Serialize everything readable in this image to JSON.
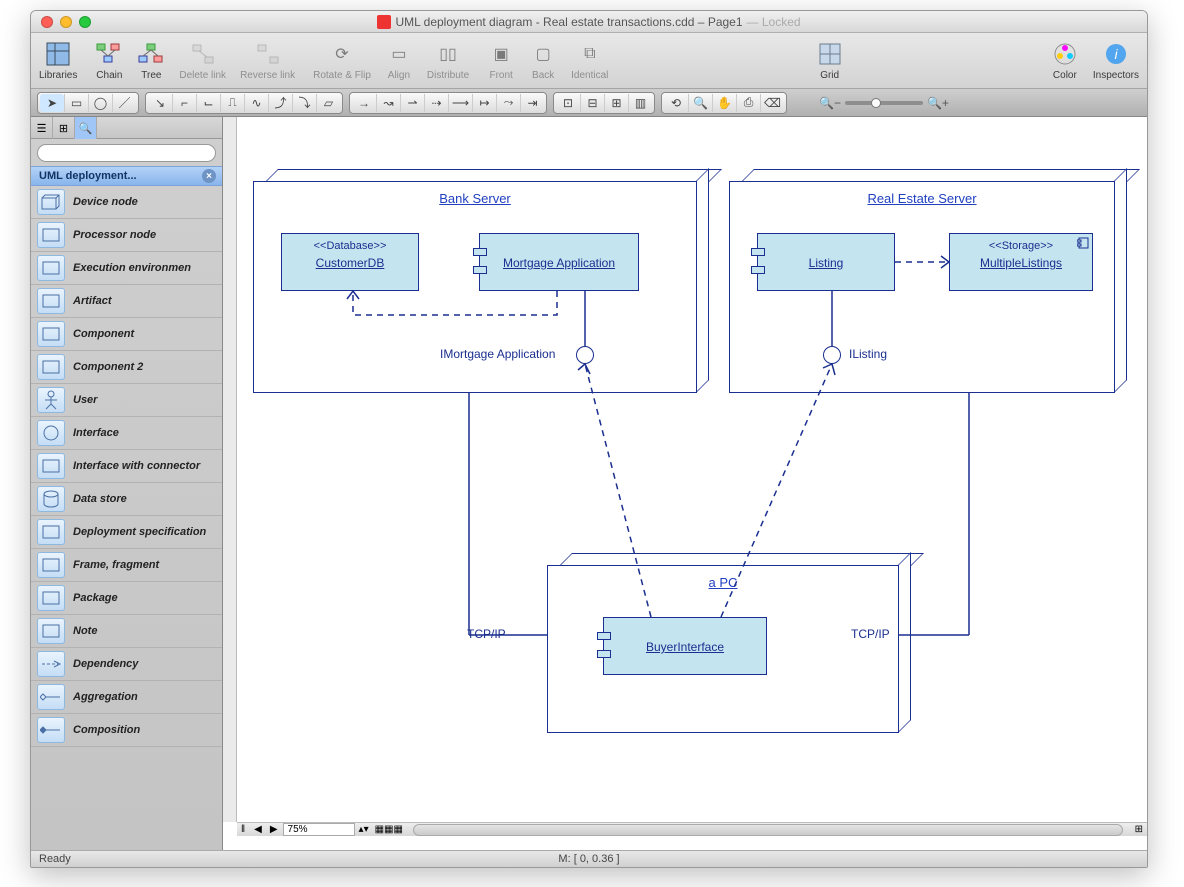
{
  "window": {
    "title_main": "UML deployment diagram - Real estate transactions.cdd – Page1",
    "title_locked": "— Locked"
  },
  "toolbar": {
    "items": [
      {
        "label": "Libraries",
        "disabled": false
      },
      {
        "label": "Chain",
        "disabled": false
      },
      {
        "label": "Tree",
        "disabled": false
      },
      {
        "label": "Delete link",
        "disabled": true
      },
      {
        "label": "Reverse link",
        "disabled": true
      },
      {
        "label": "Rotate & Flip",
        "disabled": true
      },
      {
        "label": "Align",
        "disabled": true
      },
      {
        "label": "Distribute",
        "disabled": true
      },
      {
        "label": "Front",
        "disabled": true
      },
      {
        "label": "Back",
        "disabled": true
      },
      {
        "label": "Identical",
        "disabled": true
      },
      {
        "label": "Grid",
        "disabled": false
      },
      {
        "label": "Color",
        "disabled": false
      },
      {
        "label": "Inspectors",
        "disabled": false
      }
    ]
  },
  "sidebar": {
    "section_title": "UML deployment...",
    "search_placeholder": "",
    "items": [
      {
        "label": "Device node"
      },
      {
        "label": "Processor node"
      },
      {
        "label": "Execution environmen"
      },
      {
        "label": "Artifact"
      },
      {
        "label": "Component"
      },
      {
        "label": "Component 2"
      },
      {
        "label": "User"
      },
      {
        "label": "Interface"
      },
      {
        "label": "Interface with connector"
      },
      {
        "label": "Data store"
      },
      {
        "label": "Deployment specification"
      },
      {
        "label": "Frame, fragment"
      },
      {
        "label": "Package"
      },
      {
        "label": "Note"
      },
      {
        "label": "Dependency"
      },
      {
        "label": "Aggregation"
      },
      {
        "label": "Composition"
      }
    ]
  },
  "canvas": {
    "zoom": "75%"
  },
  "diagram": {
    "bank_server": {
      "title": "Bank Server"
    },
    "customer_db": {
      "stereo": "<<Database>>",
      "name": "CustomerDB"
    },
    "mortgage_app": {
      "name": "Mortgage Application"
    },
    "real_estate_server": {
      "title": "Real Estate Server"
    },
    "listing": {
      "name": "Listing"
    },
    "multiple_listings": {
      "stereo": "<<Storage>>",
      "name": "MultipleListings"
    },
    "pc": {
      "title": "a PC"
    },
    "buyer_interface": {
      "name": "BuyerInterface"
    },
    "iface_mortgage": "IMortgage Application",
    "iface_listing": "IListing",
    "tcpip_left": "TCP/IP",
    "tcpip_right": "TCP/IP"
  },
  "status": {
    "ready": "Ready",
    "coords": "M: [ 0, 0.36 ]"
  }
}
